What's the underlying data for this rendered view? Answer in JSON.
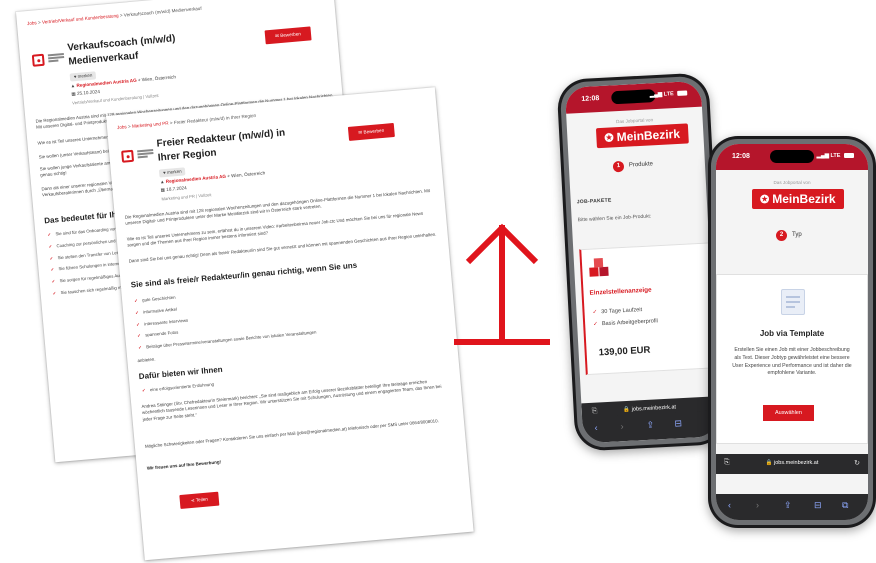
{
  "doc_back": {
    "breadcrumb_home": "Jobs",
    "breadcrumb_cat": "Vertrieb/Verkauf und Kundenberatung",
    "breadcrumb_current": "Verkaufscoach (m/w/d) Medienverkauf",
    "title": "Verkaufscoach (m/w/d) Medienverkauf",
    "apply_label": "Bewerben",
    "tag": "merken",
    "company": "Regionalmedien Austria AG",
    "location": "Wien, Österreich",
    "date": "25.10.2024",
    "category": "Vertrieb/Verkauf und Kundenberatung | Vollzeit",
    "para1": "Die Regionalmedien Austria sind mit 128 regionalen Wochenzeitungen und den dazugehörigen Online-Plattformen die Nummer 1 bei lokalen Nachrichten. Mit unseren Digital- und Printprodukten sind wir in Österreich stark vertreten.",
    "para2": "Wie es ist Teil unseres Unternehmens zu sein, erfährst du in unserem Video: #arbeitenbeirma neuer Job.ctc",
    "para3": "Sie wollen (unser Verkaufsteam) bei der Arbeit unterstützen",
    "para4": "Sie wollen junge Verkaufstalente am Anfang ihrer Karriere begleiten, Vertrieb und Coaching-Expertise weitergeben und stärken, dann sind Sie bei uns genau richtig!",
    "para5": "Dann als einer unserer regionalen Verkaufscoaches mit Verantwortung für Quereinsteigerinnen im Medienverkauf. Gestalten Sie die Ausbildung unserer Verkaufsberaterinnen durch „Übernahmen“ der Lerninhalte und Coachings zur Unterstützung der jeweiligen Vorgesetzten.",
    "heading": "Das bedeutet für Ihre Tätigkeit",
    "bullets": [
      "Sie sind für das Onboarding von Verkaufsnachwuchs verantwortlich, begleiten diese von Anfang an",
      "Coaching zur persönlichen und fachlichen Entwicklung",
      "Sie stellen den Transfer von Lerninhalten in den täglichen Medienverkauf sicher",
      "Sie führen Schulungen in interne Systeme durch",
      "Sie sorgen für regelmäßiges Austausch mit den Vorgesetzten, mit dem Ziel, die Entwicklung zu steigern",
      "Sie tauschen sich regelmäßig mit den Vorgesetzten der Programmleitung „Medienverkauf“ aus und gestalten das Programm bei"
    ]
  },
  "doc_front": {
    "breadcrumb_home": "Jobs",
    "breadcrumb_cat": "Marketing und PR",
    "breadcrumb_current": "Freier Redakteur (m/w/d) in Ihrer Region",
    "title": "Freier Redakteur (m/w/d) in Ihrer Region",
    "apply_label": "Bewerben",
    "tag": "merken",
    "company": "Regionalmedien Austria AG",
    "location": "Wien, Österreich",
    "date": "18.7.2024",
    "category": "Marketing und PR | Vollzeit",
    "para1": "Die Regionalmedien Austria sind mit 128 regionalen Wochenzeitungen und den dazugehörigen Online-Plattformen die Nummer 1 bei lokalen Nachrichten. Mit unseren Digital- und Printprodukten unter der Marke MeinBezirk sind wir in Österreich stark vertreten.",
    "para2": "Wie es ist Teil unseres Unternehmens zu sein, erfährst du in unserem Video: #arbeitenbeirma neuer Job.ctc Und möchten Sie bei uns für regionale News sorgen und die Themen aus Ihrer Region immer bestens informiert sind?",
    "para3": "Dann sind Sie bei uns genau richtig! Denn als freie/r Redakteur/in sind Sie gut vernetzt und können mit spannenden Geschichten aus Ihrer Region unterhalten.",
    "heading": "Sie sind als freie/r Redakteur/in genau richtig, wenn Sie uns",
    "bullets": [
      "gute Geschichten",
      "informative Artikel",
      "interessante Interviews",
      "spannende Fotos",
      "Beiträge über Pressetermine/veranstaltungen sowie Berichte von lokalen Veranstaltungen"
    ],
    "liefern": "anbieten.",
    "heading2": "Dafür bieten wir Ihnen",
    "offer": "eine erfolgsorientierte Entlohnung",
    "quote": "Andrea Sittinger (Stv. Chefredakteurin Steiermark) berichtet: „Sie sind maßgeblich am Erfolg unserer Bezirksblätter beteiligt! Ihre Beiträge erreichen wöchentlich tausende Leserinnen und Leser in Ihrer Region. Wir unterstützen Sie mit Schulungen, Ausrüstung und einem engagierten Team, das Ihnen bei jeder Frage zur Seite steht.“",
    "contact": "Mögliche Schwierigkeiten oder Fragen? Kontaktieren Sie uns einfach per Mail (jobs@regionalmedien.at) telefonisch oder per SMS unter 0664/8008010.",
    "closing": "Wir freuen uns auf Ihre Bewerbung!",
    "share_label": "Teilen"
  },
  "phone1": {
    "time": "12:08",
    "network": "LTE",
    "portal_label": "Das Jobportal von",
    "brand": "MeinBezirk",
    "step_num": "1",
    "step_label": "Produkte",
    "section": "JOB-PAKETE",
    "subtitle": "Bitte wählen Sie ein Job-Produkt:",
    "package_title": "Einzelstellenanzeige",
    "feature1": "30 Tage Laufzeit",
    "feature2": "Basis Arbeitgeberprofil",
    "price": "139,00 EUR",
    "url": "jobs.meinbezirk.at"
  },
  "phone2": {
    "time": "12:08",
    "network": "LTE",
    "portal_label": "Das Jobportal von",
    "brand": "MeinBezirk",
    "step_num": "2",
    "step_label": "Typ",
    "template_title": "Job via Template",
    "template_desc": "Erstellen Sie einen Job mit einer Jobbeschreibung als Text. Dieser Jobtyp gewährleistet eine bessere User Experience und Performance und ist daher die empfohlene Variante.",
    "choose_label": "Auswählen",
    "url": "jobs.meinbezirk.at"
  },
  "colors": {
    "brand_red": "#d71920",
    "status_red": "#b5152b"
  }
}
